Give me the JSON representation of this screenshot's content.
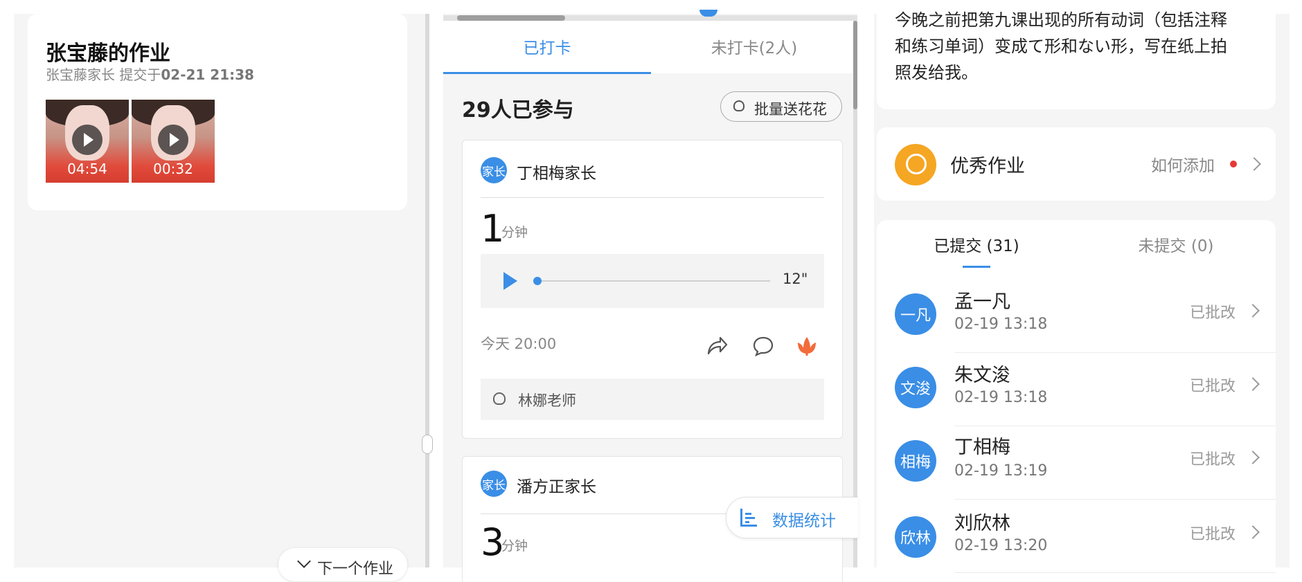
{
  "left_panel": {
    "title": "张宝藤的作业",
    "subtitle_prefix": "张宝藤家长 提交于",
    "subtitle_time": "02-21 21:38",
    "videos": [
      {
        "duration": "04:54"
      },
      {
        "duration": "00:32"
      }
    ],
    "next_button": "下一个作业"
  },
  "middle_panel": {
    "tabs": [
      {
        "label": "已打卡"
      },
      {
        "label": "未打卡(2人)"
      }
    ],
    "participants": "29人已参与",
    "batch_button": "批量送花花",
    "entries": [
      {
        "badge": "家长",
        "name": "丁相梅家长",
        "minutes": "1",
        "unit": "分钟",
        "audio_length": "12\"",
        "time": "今天 20:00",
        "flower_from": "林娜老师"
      },
      {
        "badge": "家长",
        "name": "潘方正家长",
        "minutes": "3",
        "unit": "分钟"
      }
    ],
    "stats_button": "数据统计"
  },
  "right_panel": {
    "description": "今晚之前把第九课出现的所有动词（包括注释和练习单词）变成て形和ない形，写在纸上拍照发给我。",
    "excellent_label": "优秀作业",
    "how_to_add": "如何添加",
    "tabs": [
      {
        "label": "已提交 (31)"
      },
      {
        "label": "未提交 (0)"
      }
    ],
    "submissions": [
      {
        "avatar": "一凡",
        "name": "孟一凡",
        "time": "02-19 13:18",
        "status": "已批改"
      },
      {
        "avatar": "文浚",
        "name": "朱文浚",
        "time": "02-19 13:18",
        "status": "已批改"
      },
      {
        "avatar": "相梅",
        "name": "丁相梅",
        "time": "02-19 13:19",
        "status": "已批改"
      },
      {
        "avatar": "欣林",
        "name": "刘欣林",
        "time": "02-19 13:20",
        "status": "已批改"
      }
    ],
    "colors": {
      "accent": "#3a8ee6",
      "medal": "#f5a623",
      "dot": "#e53935",
      "flower": "#f26b3a"
    }
  }
}
